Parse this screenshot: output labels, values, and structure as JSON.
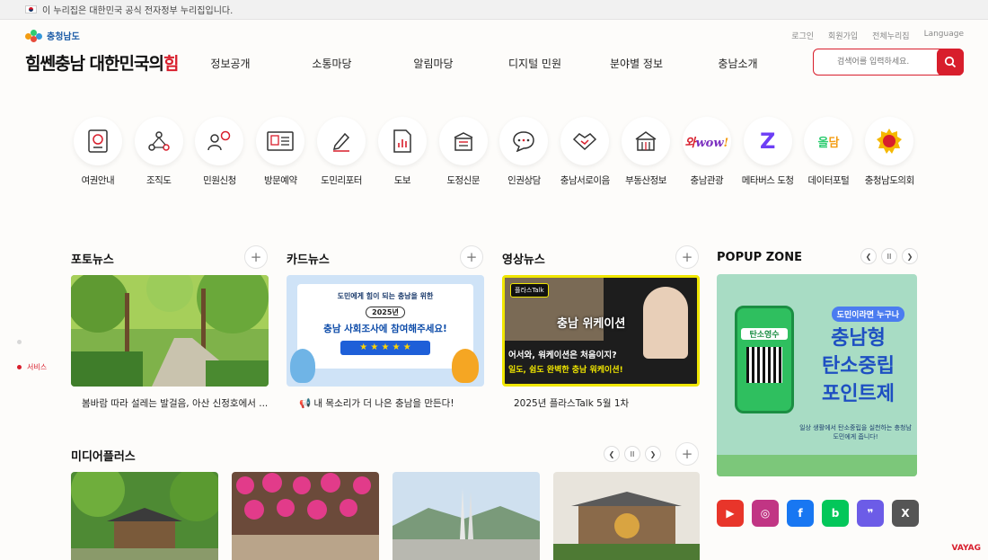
{
  "govbar": {
    "text": "이 누리집은 대한민국 공식 전자정부 누리집입니다."
  },
  "header": {
    "logo_text": "충청남도",
    "slogan_main": "힘쎈충남 대한민국의",
    "slogan_accent": "힘",
    "utils": [
      "로그인",
      "회원가입",
      "전체누리집",
      "Language"
    ],
    "gnb": [
      "정보공개",
      "소통마당",
      "알림마당",
      "디지털 민원",
      "분야별 정보",
      "충남소개"
    ],
    "search_placeholder": "검색어를 입력하세요."
  },
  "quick_menu": [
    {
      "label": "여권안내",
      "icon": "passport-icon"
    },
    {
      "label": "조직도",
      "icon": "org-chart-icon"
    },
    {
      "label": "민원신청",
      "icon": "civil-request-icon"
    },
    {
      "label": "방문예약",
      "icon": "visit-reservation-icon"
    },
    {
      "label": "도민리포터",
      "icon": "reporter-pen-icon"
    },
    {
      "label": "도보",
      "icon": "gazette-icon"
    },
    {
      "label": "도정신문",
      "icon": "newspaper-icon"
    },
    {
      "label": "인권상담",
      "icon": "chat-bubble-icon"
    },
    {
      "label": "충남서로이음",
      "icon": "handshake-icon"
    },
    {
      "label": "부동산정보",
      "icon": "building-icon"
    },
    {
      "label": "충남관광",
      "icon": "wow-tourism-icon"
    },
    {
      "label": "메타버스 도청",
      "icon": "metaverse-z-icon"
    },
    {
      "label": "데이터포털",
      "icon": "data-portal-icon"
    },
    {
      "label": "충청남도의회",
      "icon": "council-emblem-icon"
    }
  ],
  "side_nav": {
    "label": "서비스"
  },
  "photo_news": {
    "title": "포토뉴스",
    "caption": "봄바람 따라 설레는 발걸음, 아산 신정호에서 ..."
  },
  "card_news": {
    "title": "카드뉴스",
    "caption": "📢 내 목소리가 더 나은 충남을 만든다!",
    "img_line1": "도민에게 힘이 되는 충남을 위한",
    "img_year": "2025년",
    "img_line2": "충남 사회조사에 참여해주세요!"
  },
  "video_news": {
    "title": "영상뉴스",
    "caption": "2025년 플라스Talk 5월 1차",
    "img_tag": "플라스Talk",
    "img_line1": "충남 위케이션",
    "img_line2": "어서와, 워케이션은 처음이지?",
    "img_line3": "일도, 쉼도 완벽한 충남 워케이션!"
  },
  "popup_zone": {
    "title": "POPUP ZONE",
    "badge": "도민이라면 누구나",
    "line1": "충남형",
    "line2": "탄소중립",
    "line3": "포인트제",
    "phone_text": "탄소영수",
    "sub": "일상 생활에서 탄소중립을 실천하는 충청남도민에게 줍니다!",
    "pause": "II"
  },
  "media_plus": {
    "title": "미디어플러스",
    "pause": "II"
  },
  "social": [
    {
      "name": "youtube-icon",
      "glyph": "▶",
      "color": "#e8352a"
    },
    {
      "name": "instagram-icon",
      "glyph": "◎",
      "color": "#c13584"
    },
    {
      "name": "facebook-icon",
      "glyph": "f",
      "color": "#1877f2"
    },
    {
      "name": "blog-icon",
      "glyph": "b",
      "color": "#03c75a"
    },
    {
      "name": "kakao-story-icon",
      "glyph": "❞",
      "color": "#6c5ce7"
    },
    {
      "name": "x-icon",
      "glyph": "X",
      "color": "#555555"
    }
  ],
  "watermark": "VAYAG",
  "colors": {
    "accent": "#d81e2c",
    "brand_blue": "#1a5aa6"
  }
}
